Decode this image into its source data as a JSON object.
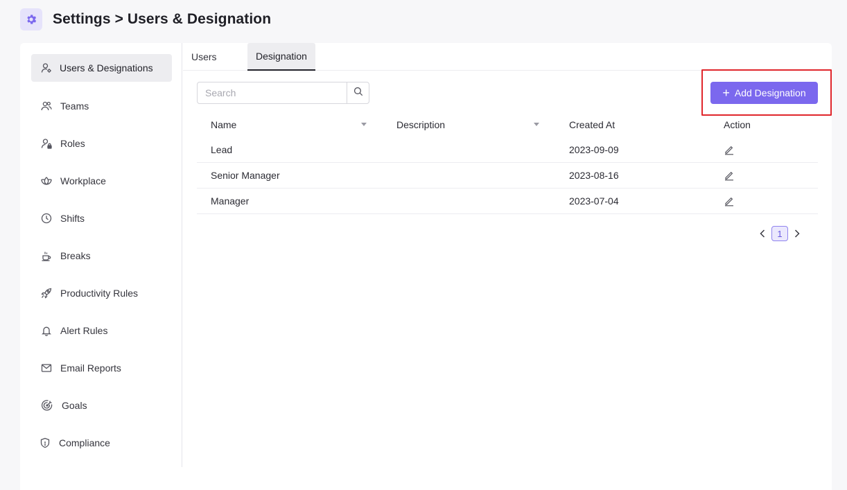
{
  "header": {
    "title": "Settings > Users & Designation",
    "icon": "gear-icon"
  },
  "sidebar": {
    "items": [
      {
        "label": "Users & Designations",
        "icon": "user-gear-icon",
        "active": true
      },
      {
        "label": "Teams",
        "icon": "users-icon"
      },
      {
        "label": "Roles",
        "icon": "user-lock-icon"
      },
      {
        "label": "Workplace",
        "icon": "lotus-icon"
      },
      {
        "label": "Shifts",
        "icon": "clock-icon"
      },
      {
        "label": "Breaks",
        "icon": "coffee-icon"
      },
      {
        "label": "Productivity Rules",
        "icon": "rocket-icon"
      },
      {
        "label": "Alert Rules",
        "icon": "bell-icon"
      },
      {
        "label": "Email Reports",
        "icon": "mail-icon"
      },
      {
        "label": "Goals",
        "icon": "target-icon"
      },
      {
        "label": "Compliance",
        "icon": "shield-icon"
      }
    ]
  },
  "tabs": [
    {
      "label": "Users",
      "active": false
    },
    {
      "label": "Designation",
      "active": true
    }
  ],
  "search": {
    "placeholder": "Search",
    "value": ""
  },
  "add_button": {
    "label": "Add Designation"
  },
  "table": {
    "columns": [
      "Name",
      "Description",
      "Created At",
      "Action"
    ],
    "rows": [
      {
        "name": "Lead",
        "description": "",
        "created_at": "2023-09-09"
      },
      {
        "name": "Senior Manager",
        "description": "",
        "created_at": "2023-08-16"
      },
      {
        "name": "Manager",
        "description": "",
        "created_at": "2023-07-04"
      }
    ]
  },
  "pagination": {
    "current_page": "1"
  },
  "colors": {
    "accent": "#7b68ee",
    "highlight": "#e0262b"
  }
}
